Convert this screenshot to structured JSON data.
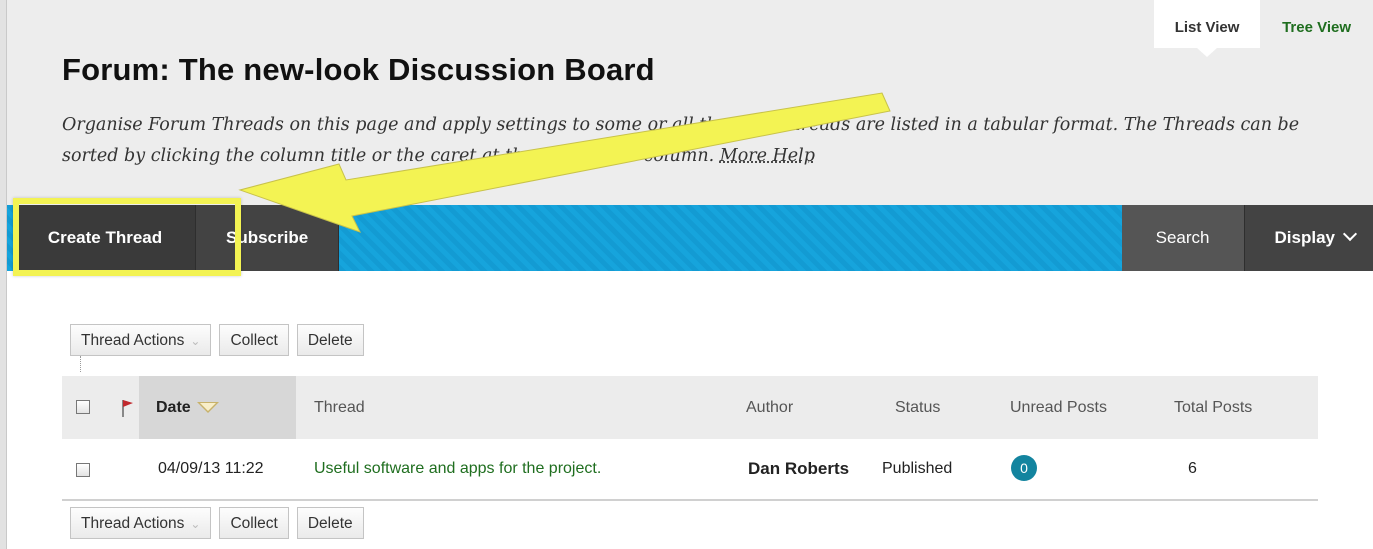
{
  "view_toggle": {
    "active": "List View",
    "inactive": "Tree View"
  },
  "page": {
    "title": "Forum: The new-look Discussion Board",
    "instructions": "Organise Forum Threads on this page and apply settings to some or all threads. Threads are listed in a tabular format. The Threads can be sorted by clicking the column title or the caret at the top of each column.",
    "help_link": "More Help"
  },
  "action_bar": {
    "create_thread": "Create Thread",
    "subscribe": "Subscribe",
    "search": "Search",
    "display": "Display",
    "accent_color": "#16a4dc"
  },
  "annotation": {
    "highlight_color": "#f3f353"
  },
  "toolbar": {
    "thread_actions": "Thread Actions",
    "collect": "Collect",
    "delete": "Delete"
  },
  "grid": {
    "columns": {
      "date": "Date",
      "thread": "Thread",
      "author": "Author",
      "status": "Status",
      "unread": "Unread Posts",
      "total": "Total Posts"
    },
    "rows": [
      {
        "date": "04/09/13 11:22",
        "thread": "Useful software and apps for the project.",
        "author": "Dan Roberts",
        "status": "Published",
        "unread": "0",
        "total": "6"
      }
    ]
  }
}
